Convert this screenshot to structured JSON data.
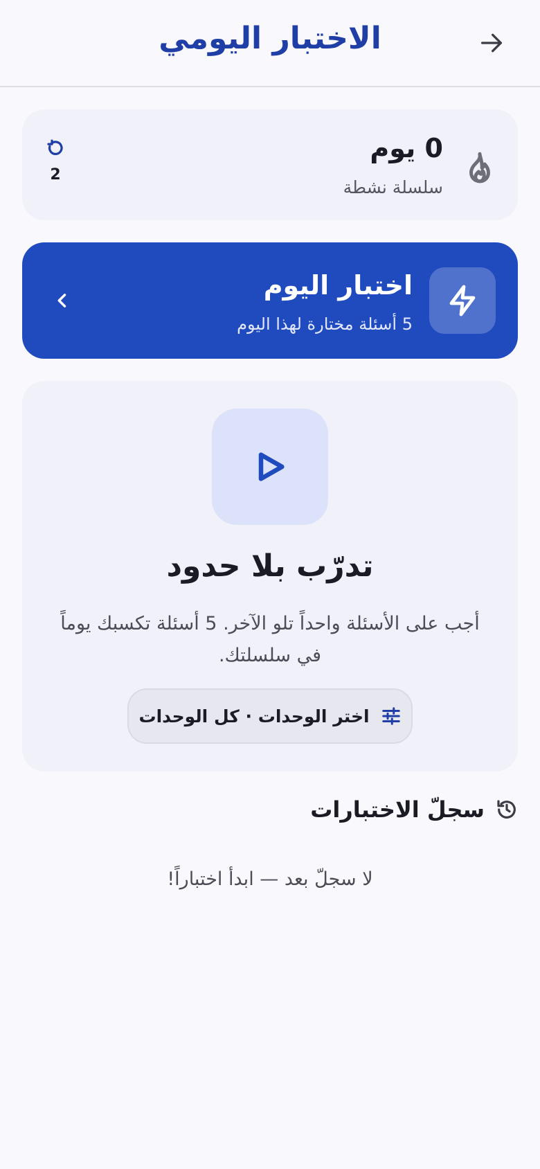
{
  "header": {
    "title": "الاختبار اليومي",
    "back_icon": "arrow-right-icon"
  },
  "streak": {
    "value": "0 يوم",
    "label": "سلسلة نشطة",
    "icon": "flame-icon",
    "refresh_icon": "refresh-icon",
    "refresh_count": "2"
  },
  "daily_quiz": {
    "title": "اختبار اليوم",
    "subtitle": "5 أسئلة مختارة لهذا اليوم",
    "icon": "bolt-icon",
    "chevron_icon": "chevron-left-icon",
    "color": "#1f4bbf"
  },
  "practice": {
    "icon": "play-icon",
    "title": "تدرّب بلا حدود",
    "description": "أجب على الأسئلة واحداً تلو الآخر. 5 أسئلة تكسبك يوماً في سلسلتك.",
    "units_button_label": "اختر الوحدات · كل الوحدات",
    "units_icon": "sliders-icon"
  },
  "history": {
    "title": "سجلّ الاختبارات",
    "icon": "history-icon",
    "empty_text": "لا سجلّ بعد — ابدأ اختباراً!"
  },
  "colors": {
    "accent": "#1f4bbf",
    "title_blue": "#1f3fa6",
    "background": "#f9f9fd",
    "card": "#f1f1f9"
  }
}
